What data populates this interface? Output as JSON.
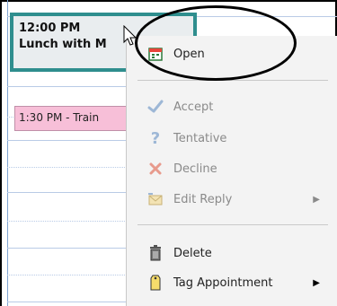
{
  "calendar": {
    "lunch_appointment": {
      "time": "12:00 PM",
      "title": "Lunch with M"
    },
    "training_appointment": {
      "label": "1:30 PM - Train"
    }
  },
  "context_menu": {
    "items": [
      {
        "label": "Open",
        "icon": "calendar-open-icon",
        "enabled": true
      },
      {
        "label": "Accept",
        "icon": "checkmark-icon",
        "enabled": false
      },
      {
        "label": "Tentative",
        "icon": "question-mark-icon",
        "enabled": false
      },
      {
        "label": "Decline",
        "icon": "x-icon",
        "enabled": false
      },
      {
        "label": "Edit Reply",
        "icon": "envelope-icon",
        "enabled": false,
        "submenu": true
      },
      {
        "label": "Delete",
        "icon": "trash-icon",
        "enabled": true
      },
      {
        "label": "Tag Appointment",
        "icon": "tag-icon",
        "enabled": true,
        "submenu": true
      }
    ]
  },
  "colors": {
    "lunch_border": "#2f8e8e",
    "training_bg": "#f7bfd8",
    "menu_bg": "#f3f3f3"
  }
}
